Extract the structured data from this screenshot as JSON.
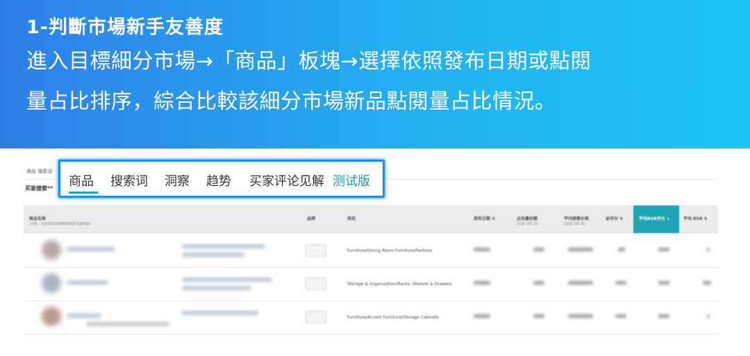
{
  "banner": {
    "title": "1-判斷市場新手友善度",
    "line1": "進入目標細分市場→「商品」板塊→選擇依照發布日期或點閱",
    "line2": "量占比排序，綜合比較該細分市場新品點閱量占比情況。"
  },
  "tabs": {
    "products": "商品",
    "search_terms": "搜索词",
    "insights": "洞察",
    "trends": "趋势",
    "reviews": "买家评论见解",
    "beta": "测试版"
  },
  "screenshot": {
    "mini_nav": "商品  搜索词",
    "mini_search": "买家搜索**",
    "columns": {
      "product_name": "商品名称",
      "product_name_sub": "(点击 - 点击商品详情跳转到亚马逊商品)",
      "brand": "品牌",
      "category": "类别",
      "launch_date": "发布日期",
      "click_share": "点击量份额",
      "click_share_sub": "(过去 360 天)",
      "avg_price": "平均销售价格",
      "avg_price_sub": "(过去 360 天)",
      "rating": "总评分",
      "reviews": "平均BSR评分",
      "avg_bsr": "平均 BSR"
    },
    "rows": [
      {
        "category": "Furniture/Dining Room Furniture/Pantries"
      },
      {
        "category": "Storage & Organization/Racks, Shelves & Drawers"
      },
      {
        "category": "Furniture/Accent Furniture/Storage Cabinets"
      }
    ]
  }
}
